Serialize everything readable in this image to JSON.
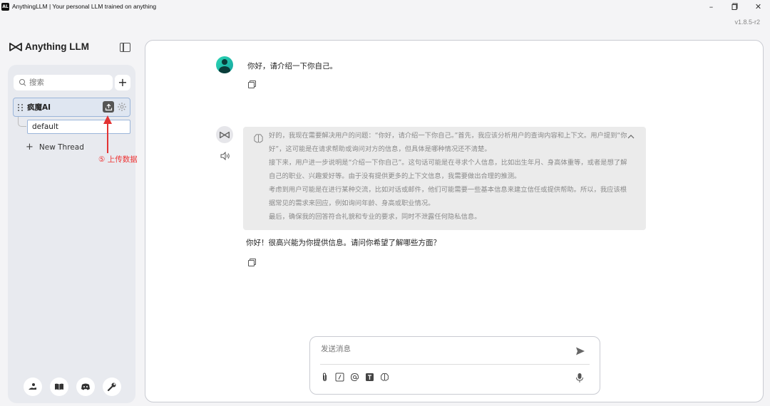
{
  "window": {
    "app_icon_text": "AL",
    "title": "AnythingLLM | Your personal LLM trained on anything",
    "controls": {
      "minimize": "–",
      "maximize": "▢",
      "close": "✕"
    },
    "version": "v1.8.5-r2"
  },
  "sidebar": {
    "logo_text": "Anything LLM",
    "search_placeholder": "搜索",
    "add_workspace_label": "+",
    "workspace": {
      "name": "疯魔AI"
    },
    "thread": {
      "name": "default"
    },
    "new_thread_label": "New Thread",
    "bottom_icons": [
      "community-hub-icon",
      "docs-icon",
      "discord-icon",
      "settings-wrench-icon"
    ]
  },
  "annotation": {
    "label": "⑤ 上传数据",
    "color": "#e33333"
  },
  "chat": {
    "user_message": "你好，请介绍一下你自己。",
    "thought": [
      "好的，我现在需要解决用户的问题：“你好，请介绍一下你自己。”首先，我应该分析用户的查询内容和上下文。用户提到“你好”，这可能是在请求帮助或询问对方的信息，但具体是哪种情况还不清楚。",
      "接下来，用户进一步说明是“介绍一下你自己”。这句话可能是在寻求个人信息，比如出生年月、身高体重等，或者是想了解自己的职业、兴趣爱好等。由于没有提供更多的上下文信息，我需要做出合理的推测。",
      "考虑到用户可能是在进行某种交流，比如对话或邮件，他们可能需要一些基本信息来建立信任或提供帮助。所以，我应该根据常见的需求来回应，例如询问年龄、身高或职业情况。",
      "最后，确保我的回答符合礼貌和专业的要求，同时不泄露任何隐私信息。"
    ],
    "bot_message": "你好！很高兴能为你提供信息。请问你希望了解哪些方面？"
  },
  "composer": {
    "placeholder": "发送消息",
    "tools": [
      "attachment-icon",
      "slash-command-icon",
      "at-mention-icon",
      "text-size-icon",
      "agent-brain-icon"
    ]
  }
}
